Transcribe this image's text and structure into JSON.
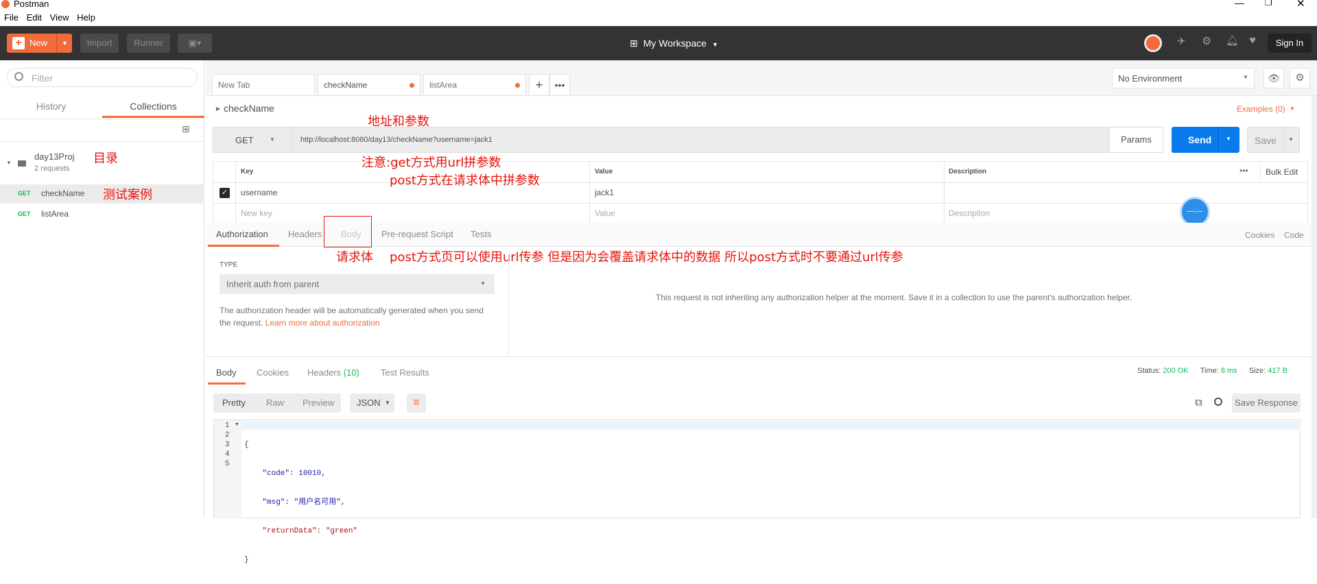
{
  "window": {
    "title": "Postman"
  },
  "menu": [
    "File",
    "Edit",
    "View",
    "Help"
  ],
  "toolbar": {
    "new_label": "New",
    "import_label": "Import",
    "runner_label": "Runner",
    "workspace_label": "My Workspace",
    "signin_label": "Sign In"
  },
  "sidebar": {
    "filter_placeholder": "Filter",
    "tabs": [
      "History",
      "Collections"
    ],
    "collection": {
      "name": "day13Proj",
      "count": "2 requests"
    },
    "requests": [
      {
        "method": "GET",
        "name": "checkName"
      },
      {
        "method": "GET",
        "name": "listArea"
      }
    ]
  },
  "tabs": [
    {
      "label": "New Tab"
    },
    {
      "label": "checkName"
    },
    {
      "label": "listArea"
    }
  ],
  "environment": {
    "selected": "No Environment"
  },
  "request": {
    "name": "checkName",
    "examples": "Examples (0)",
    "method": "GET",
    "url": "http://localhost:8080/day13/checkName?username=jack1",
    "params_label": "Params",
    "send_label": "Send",
    "save_label": "Save",
    "columns": [
      "Key",
      "Value",
      "Description"
    ],
    "bulk_edit": "Bulk Edit",
    "params": [
      {
        "key": "username",
        "value": "jack1",
        "description": ""
      }
    ],
    "new_key_placeholder": "New key",
    "value_placeholder": "Value",
    "description_placeholder": "Description"
  },
  "req_tabs": [
    "Authorization",
    "Headers",
    "Body",
    "Pre-request Script",
    "Tests"
  ],
  "req_links": {
    "cookies": "Cookies",
    "code": "Code"
  },
  "auth": {
    "type_label": "TYPE",
    "type_value": "Inherit auth from parent",
    "help_text": "The authorization header will be automatically generated when you send the request.",
    "learn_more": "Learn more about authorization",
    "info": "This request is not inheriting any authorization helper at the moment. Save it in a collection to use the parent's authorization helper."
  },
  "response": {
    "tabs": [
      "Body",
      "Cookies",
      "Headers",
      "Test Results"
    ],
    "headers_count": "(10)",
    "status_label": "Status:",
    "status_value": "200 OK",
    "time_label": "Time:",
    "time_value": "8 ms",
    "size_label": "Size:",
    "size_value": "417 B",
    "view_modes": [
      "Pretty",
      "Raw",
      "Preview"
    ],
    "format": "JSON",
    "save_response": "Save Response",
    "line_numbers": [
      "1",
      "2",
      "3",
      "4",
      "5"
    ],
    "lines": [
      "{",
      "    \"code\": 10010,",
      "    \"msg\": \"用户名可用\",",
      "    \"returnData\": \"green\"",
      "}"
    ]
  },
  "annotations": {
    "address": "地址和参数",
    "note1": "注意:get方式用url拼参数",
    "note2": "post方式在请求体中拼参数",
    "dir": "目录",
    "test": "测试案例",
    "body": "请求体",
    "post_note": "post方式页可以使用url传参 但是因为会覆盖请求体中的数据 所以post方式时不要通过url传参"
  },
  "colors": {
    "accent": "#f26b3a",
    "send": "#097bed",
    "dark": "#333333",
    "annotation": "#e8120c"
  }
}
